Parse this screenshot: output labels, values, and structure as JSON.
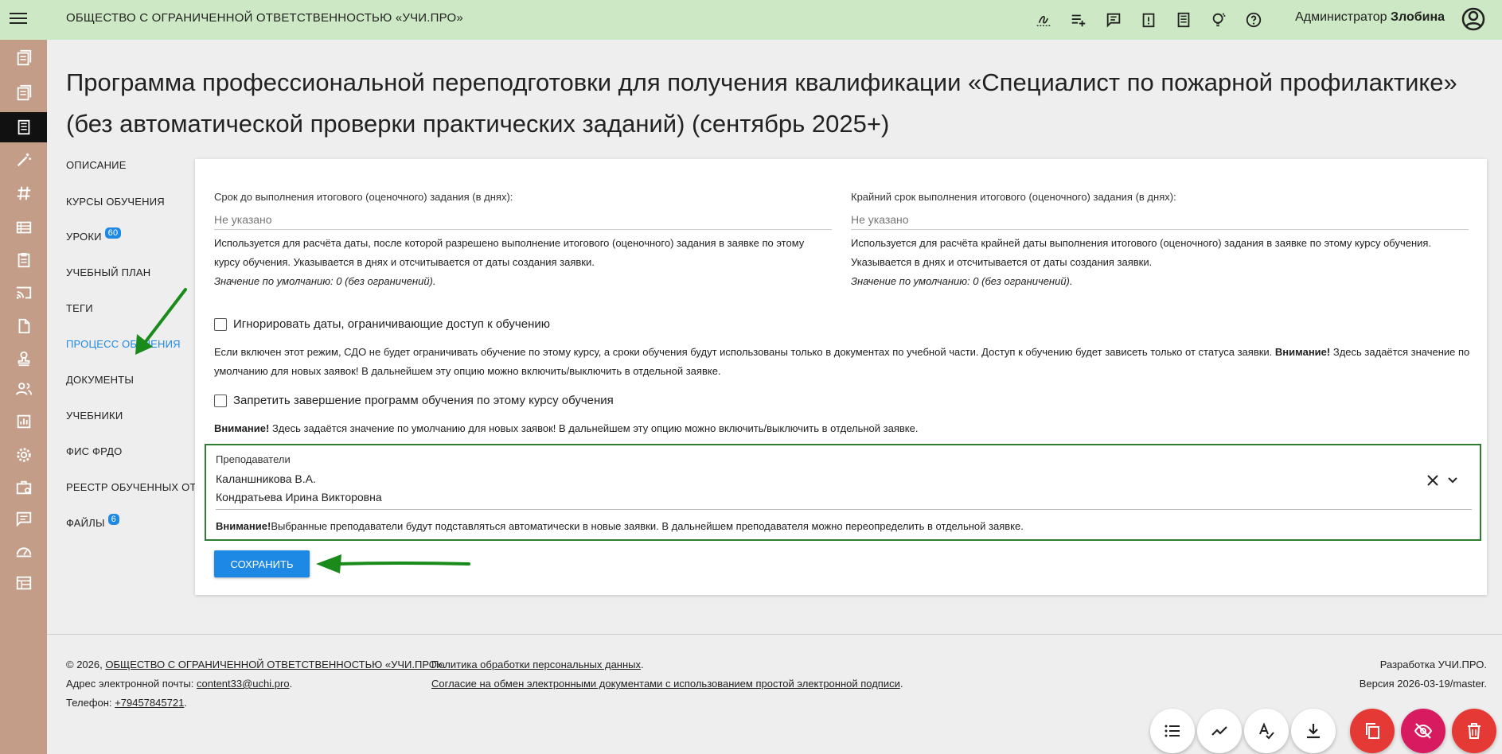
{
  "header": {
    "org_title": "ОБЩЕСТВО С ОГРАНИЧЕННОЙ ОТВЕТСТВЕННОСТЬЮ «УЧИ.ПРО»",
    "user_role": "Администратор",
    "user_name": "Злобина"
  },
  "page": {
    "title": "Программа профессиональной переподготовки для получения квалификации «Специалист по пожарной профилактике» (без автоматической проверки практических заданий) (сентябрь 2025+)"
  },
  "sidenav": {
    "items": [
      {
        "label": "ОПИСАНИЕ"
      },
      {
        "label": "КУРСЫ ОБУЧЕНИЯ"
      },
      {
        "label": "УРОКИ",
        "badge": "60"
      },
      {
        "label": "УЧЕБНЫЙ ПЛАН"
      },
      {
        "label": "ТЕГИ"
      },
      {
        "label": "ПРОЦЕСС ОБУЧЕНИЯ"
      },
      {
        "label": "ДОКУМЕНТЫ"
      },
      {
        "label": "УЧЕБНИКИ"
      },
      {
        "label": "ФИС ФРДО"
      },
      {
        "label": "РЕЕСТР ОБУЧЕННЫХ ОТ"
      },
      {
        "label": "ФАЙЛЫ",
        "badge": "6"
      }
    ]
  },
  "form": {
    "deadline_days_label": "Срок до выполнения итогового (оценочного) задания (в днях):",
    "deadline_days_placeholder": "Не указано",
    "deadline_days_help": "Используется для расчёта даты, после которой разрешено выполнение итогового (оценочного) задания в заявке по этому курсу обучения. Указывается в днях и отсчитывается от даты создания заявки.",
    "deadline_days_default": "Значение по умолчанию: 0 (без ограничений).",
    "final_deadline_label": "Крайний срок выполнения итогового (оценочного) задания (в днях):",
    "final_deadline_placeholder": "Не указано",
    "final_deadline_help": "Используется для расчёта крайней даты выполнения итогового (оценочного) задания в заявке по этому курсу обучения. Указывается в днях и отсчитывается от даты создания заявки.",
    "final_deadline_default": "Значение по умолчанию: 0 (без ограничений).",
    "ignore_dates_label": "Игнорировать даты, ограничивающие доступ к обучению",
    "ignore_dates_text": "Если включен этот режим, СДО не будет ограничивать обучение по этому курсу, а сроки обучения будут использованы только в документах по учебной части. Доступ к обучению будет зависеть только от статуса заявки.",
    "ignore_dates_warning": "Внимание!",
    "ignore_dates_text2": "Здесь задаётся значение по умолчанию для новых заявок! В дальнейшем эту опцию можно включить/выключить в отдельной заявке.",
    "forbid_finish_label": "Запретить завершение программ обучения по этому курсу обучения",
    "forbid_finish_warning": "Внимание!",
    "forbid_finish_text": "Здесь задаётся значение по умолчанию для новых заявок! В дальнейшем эту опцию можно включить/выключить в отдельной заявке.",
    "teachers_label": "Преподаватели",
    "teachers": [
      "Каланшникова В.А.",
      "Кондратьева Ирина Викторовна"
    ],
    "teachers_warning": "Внимание!",
    "teachers_note": "Выбранные преподаватели будут подставляться автоматически в новые заявки. В дальнейшем преподавателя можно переопределить в отдельной заявке.",
    "save_label": "СОХРАНИТЬ"
  },
  "footer": {
    "copyright": "©  2026,",
    "org_link": "ОБЩЕСТВО С ОГРАНИЧЕННОЙ ОТВЕТСТВЕННОСТЬЮ «УЧИ.ПРО»",
    "email_label": "Адрес электронной почты:",
    "email": "content33@uchi.pro",
    "phone_label": "Телефон:",
    "phone": "+79457845721",
    "privacy_link": "Политика обработки персональных данных",
    "agreement_link": "Согласие на обмен электронными документами с использованием простой электронной подписи",
    "developer": "Разработка УЧИ.ПРО.",
    "version": "Версия 2026-03-19/master."
  },
  "colors": {
    "topbar": "#cde8c4",
    "rail": "#c49d88",
    "accent": "#1e88e5",
    "highlight_border": "#2e7d32",
    "annotation_arrow": "#1a8a1a"
  }
}
